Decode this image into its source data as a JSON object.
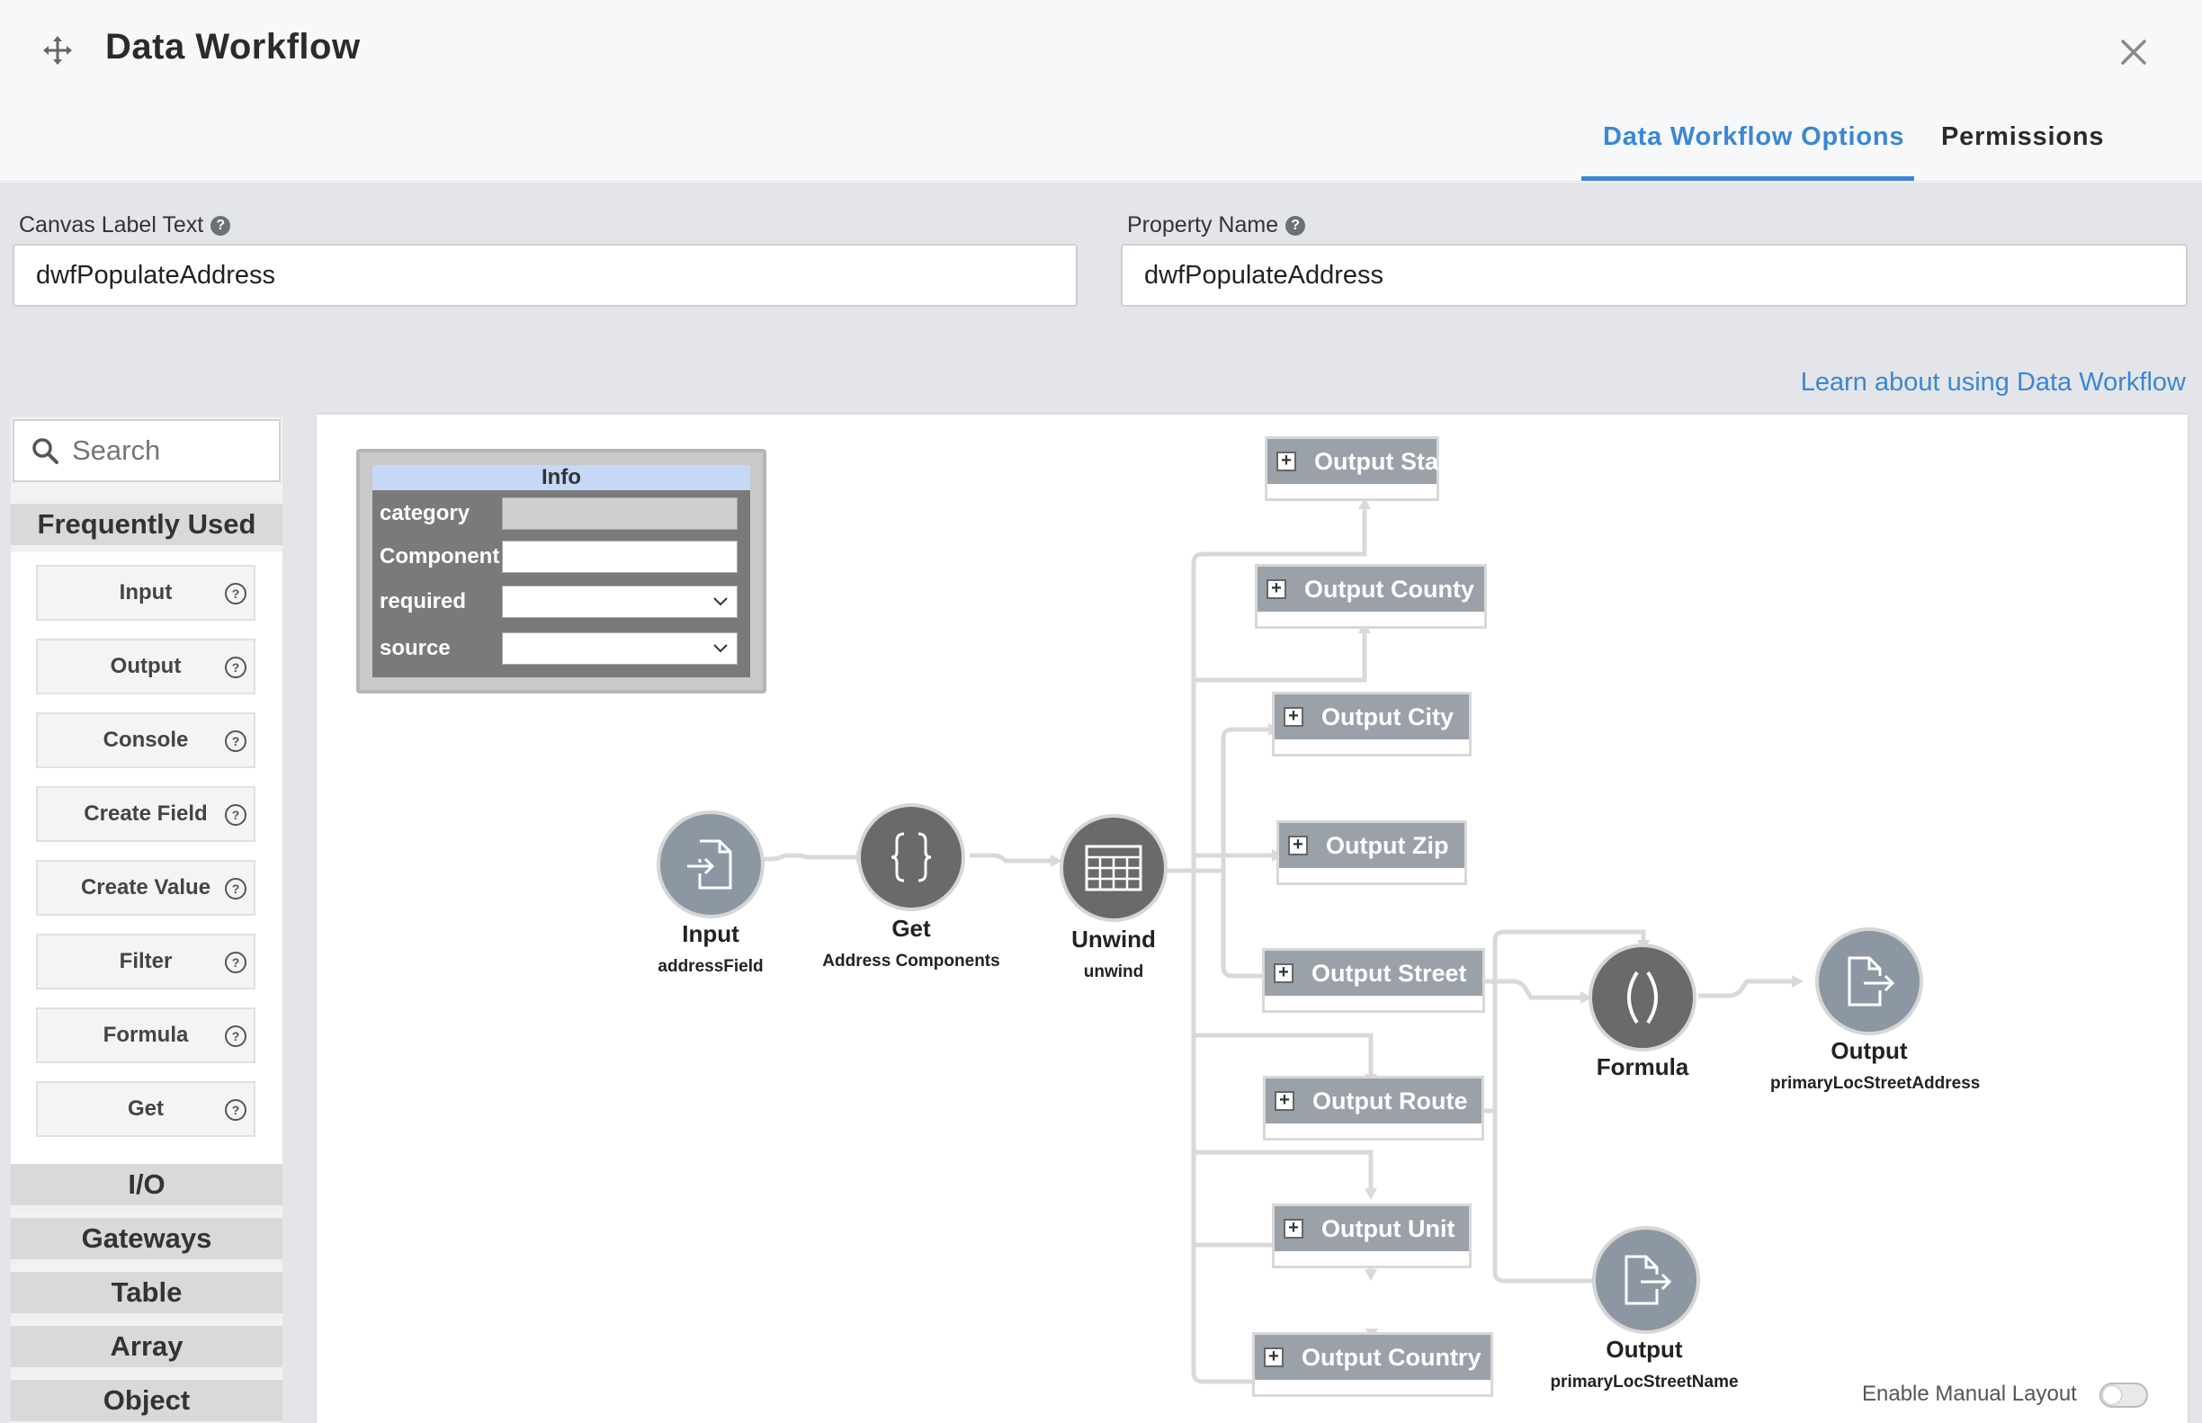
{
  "header": {
    "title": "Data Workflow",
    "tabs": [
      {
        "label": "Data Workflow Options",
        "active": true
      },
      {
        "label": "Permissions",
        "active": false
      }
    ],
    "accent_color": "#3a87d6"
  },
  "form": {
    "canvas_label": {
      "label": "Canvas Label Text",
      "value": "dwfPopulateAddress"
    },
    "property_name": {
      "label": "Property Name",
      "value": "dwfPopulateAddress"
    },
    "help_glyph": "?",
    "learn_link": "Learn about using Data Workflow"
  },
  "sidebar": {
    "search_placeholder": "Search",
    "frequently_used": {
      "label": "Frequently Used",
      "items": [
        "Input",
        "Output",
        "Console",
        "Create Field",
        "Create Value",
        "Filter",
        "Formula",
        "Get"
      ]
    },
    "groups": [
      "I/O",
      "Gateways",
      "Table",
      "Array",
      "Object"
    ]
  },
  "canvas": {
    "info": {
      "title": "Info",
      "rows": [
        {
          "key": "category",
          "value": ""
        },
        {
          "key": "Component",
          "value": ""
        },
        {
          "key": "required",
          "value": ""
        },
        {
          "key": "source",
          "value": ""
        }
      ]
    },
    "nodes": {
      "input": {
        "title": "Input",
        "sub": "addressField",
        "icon": "file-import-icon"
      },
      "get": {
        "title": "Get",
        "sub": "Address Components",
        "icon": "curly-braces-icon"
      },
      "unwind": {
        "title": "Unwind",
        "sub": "unwind",
        "icon": "table-icon"
      },
      "formula": {
        "title": "Formula",
        "sub": "",
        "icon": "parentheses-icon"
      },
      "output_addr": {
        "title": "Output",
        "sub": "primaryLocStreetAddress",
        "icon": "file-export-icon"
      },
      "output_name": {
        "title": "Output",
        "sub": "primaryLocStreetName",
        "icon": "file-export-icon"
      }
    },
    "outputs": [
      "Output State",
      "Output County",
      "Output City",
      "Output Zip",
      "Output Street",
      "Output Route",
      "Output Unit",
      "Output Country"
    ],
    "manual_layout_label": "Enable Manual Layout",
    "manual_layout_enabled": false
  }
}
